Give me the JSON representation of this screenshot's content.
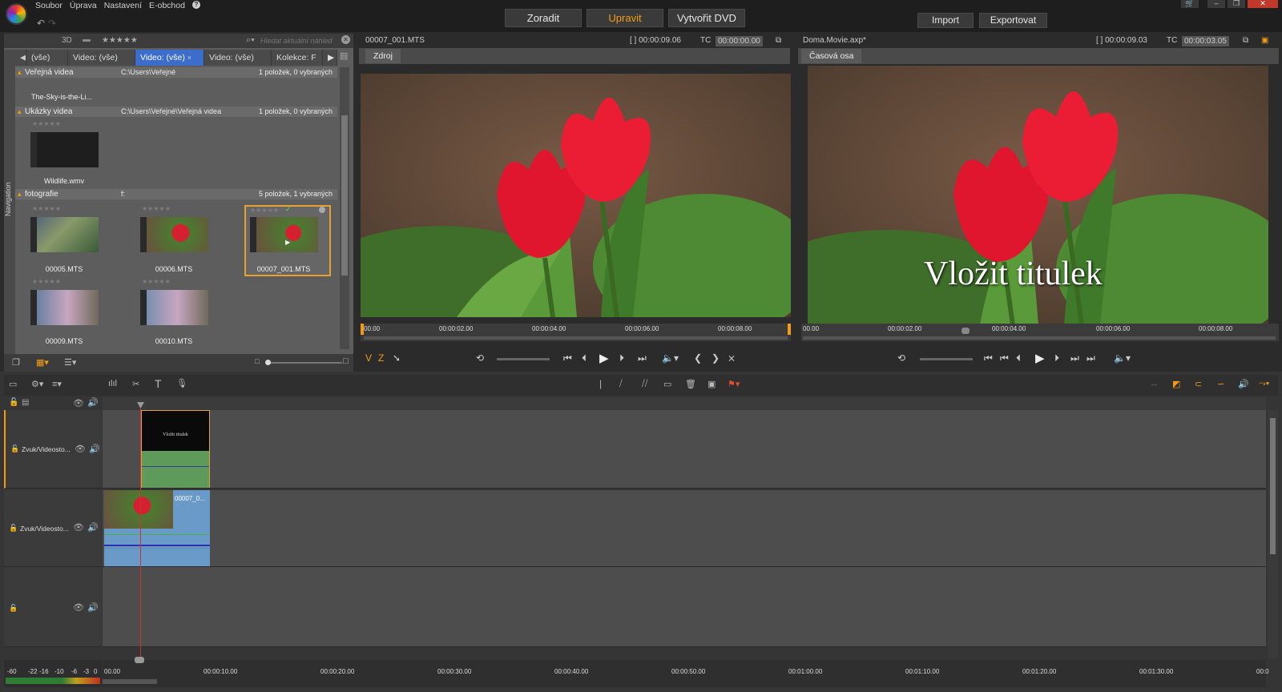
{
  "menu": {
    "items": [
      "Soubor",
      "Úprava",
      "Nastavení",
      "E-obchod"
    ],
    "help": "?"
  },
  "modes": {
    "organize": "Zoradit",
    "edit": "Upravit",
    "dvd": "Vytvořit DVD",
    "import": "Import",
    "export": "Exportovat"
  },
  "colors": {
    "accent": "#f39c12",
    "active_tab": "#3d6dcc",
    "selection": "#e8a030",
    "playhead": "#d32f2f"
  },
  "library": {
    "filter_3d": "3D",
    "rating": "★★★★★",
    "search_placeholder": "Hledat aktuální náhled",
    "tabs": [
      "(vše)",
      "Video: (vše)",
      "Video: (vše)",
      "Video: (vše)",
      "Kolekce: F"
    ],
    "nav_label": "Navigation",
    "groups": [
      {
        "title": "Veřejná videa",
        "path": "C:\\Users\\Veřejné",
        "count": "1 položek, 0 vybraných",
        "items": [
          {
            "name": "The-Sky-is-the-Li..."
          }
        ]
      },
      {
        "title": "Ukázky videa",
        "path": "C:\\Users\\Veřejné\\Veřejná videa",
        "count": "1 položek, 0 vybraných",
        "items": [
          {
            "name": "Wildlife.wmv"
          }
        ]
      },
      {
        "title": "fotografie",
        "path": "f:",
        "count": "5 položek, 1 vybraných",
        "items": [
          {
            "name": "00005.MTS"
          },
          {
            "name": "00006.MTS"
          },
          {
            "name": "00007_001.MTS"
          },
          {
            "name": "00009.MTS"
          },
          {
            "name": "00010.MTS"
          }
        ]
      }
    ]
  },
  "source": {
    "title": "00007_001.MTS",
    "duration": "[ ] 00:00:09.06",
    "tc_label": "TC",
    "tc": "00:00:00.00",
    "tab": "Zdroj",
    "ruler": [
      "00.00",
      "00:00:02.00",
      "00:00:04.00",
      "00:00:06.00",
      "00:00:08.00"
    ],
    "marks": {
      "v": "V",
      "z": "Z"
    }
  },
  "timeline_preview": {
    "title": "Doma.Movie.axp*",
    "duration": "[ ] 00:00:09.03",
    "tc_label": "TC",
    "tc": "00:00:03.05",
    "tab": "Časová osa",
    "title_overlay": "Vložit titulek",
    "ruler": [
      "00.00",
      "00:00:02.00",
      "00:00:04.00",
      "00:00:06.00",
      "00:00:08.00"
    ]
  },
  "timeline": {
    "tracks": [
      {
        "name": "Zvuk/Videosto..."
      },
      {
        "name": "Zvuk/Videosto..."
      },
      {
        "name": ""
      }
    ],
    "clips": {
      "title_clip_text": "Vložit titulek",
      "video_clip": "00007_0..."
    },
    "ruler": [
      "00.00",
      "00:00:10.00",
      "00:00:20.00",
      "00:00:30.00",
      "00:00:40.00",
      "00:00:50.00",
      "00:01:00.00",
      "00:01:10.00",
      "00:01:20.00",
      "00:01:30.00",
      "00:0"
    ],
    "meter": [
      "-60",
      "-22",
      "-16",
      "-10",
      "-6",
      "-3",
      "0"
    ]
  }
}
